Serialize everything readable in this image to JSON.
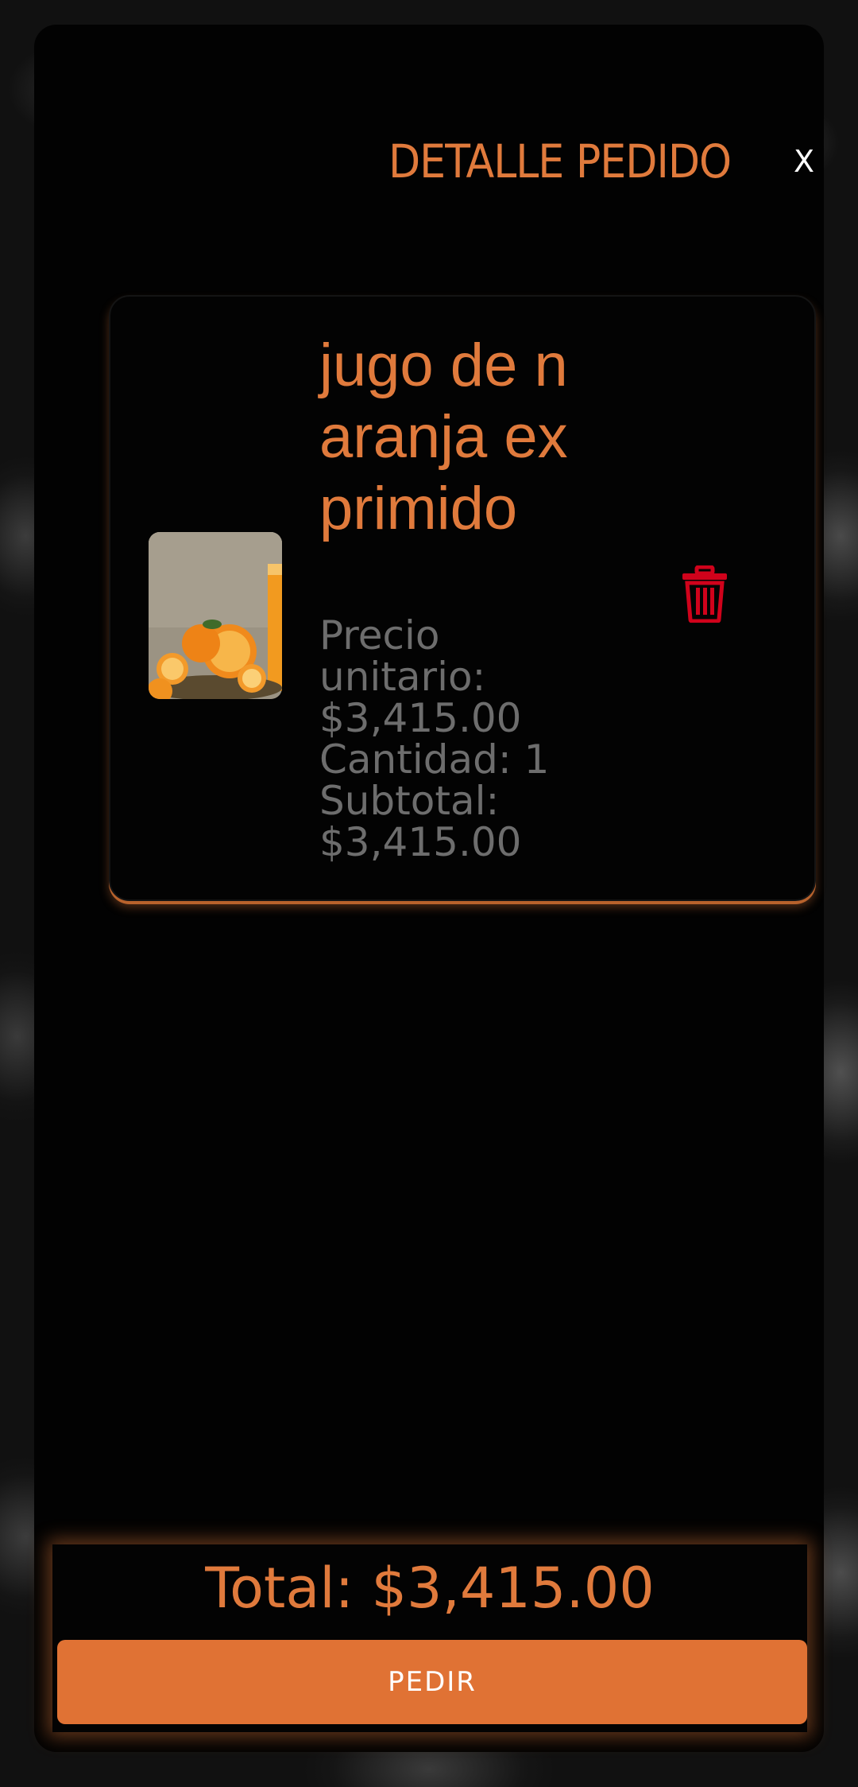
{
  "header": {
    "title": "DETALLE PEDIDO",
    "close_label": "X"
  },
  "order": {
    "items": [
      {
        "name": "jugo de naranja exprimido",
        "unit_price_label": "Precio unitario: $3,415.00",
        "quantity_label": "Cantidad: 1",
        "subtotal_label": "Subtotal: $3,415.00",
        "image_icon": "orange-juice-photo",
        "delete_icon": "trash-icon"
      }
    ]
  },
  "footer": {
    "total_label": "Total: $3,415.00",
    "order_button_label": "PEDIR"
  },
  "colors": {
    "accent": "#e07a3c",
    "button": "#e07234",
    "delete": "#d0021b",
    "muted_text": "#6d6d6d"
  }
}
